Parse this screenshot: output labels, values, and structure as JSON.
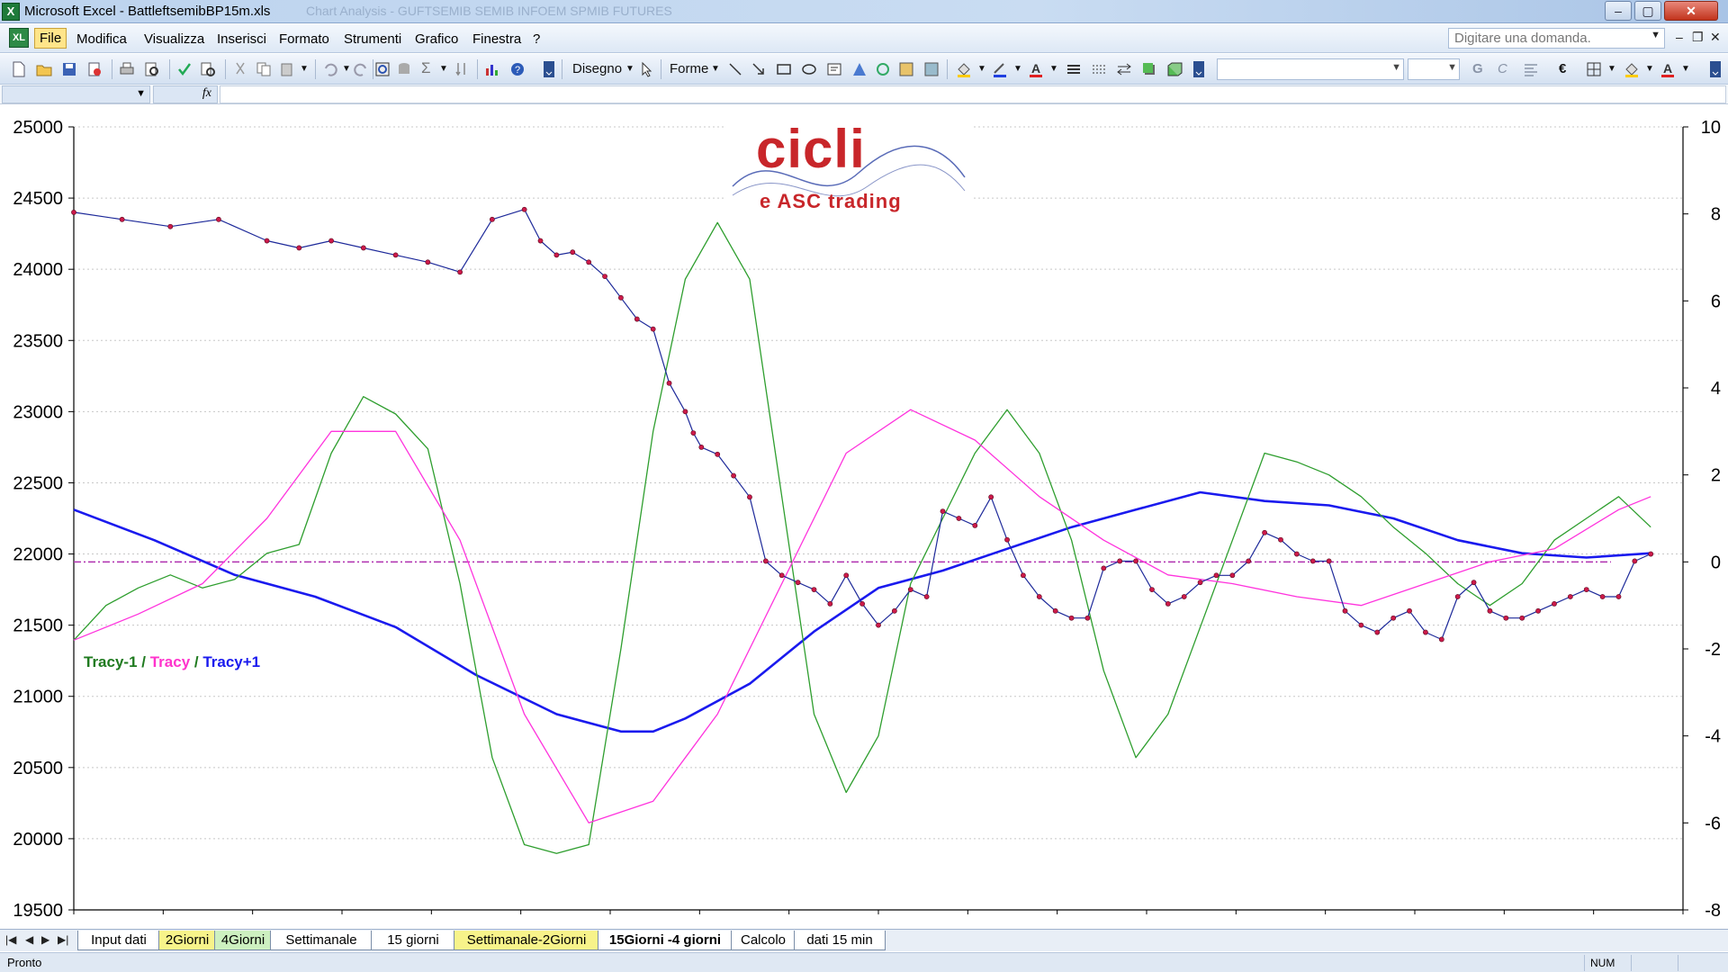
{
  "window": {
    "app_title": "Microsoft Excel - BattleftsemibBP15m.xls",
    "ghost_title": "Chart Analysis - GUFTSEMIB SEMIB INFOEM SPMIB FUTURES"
  },
  "menu": {
    "items": [
      "File",
      "Modifica",
      "Visualizza",
      "Inserisci",
      "Formato",
      "Strumenti",
      "Grafico",
      "Finestra",
      "?"
    ],
    "ask_placeholder": "Digitare una domanda."
  },
  "toolbar": {
    "draw_label": "Disegno",
    "shapes_label": "Forme",
    "bold_label": "G",
    "italic_label": "C",
    "euro_label": "€",
    "fx_label": "fx"
  },
  "chart": {
    "left_axis": {
      "min": 19500,
      "max": 25000,
      "step": 500,
      "ticks": [
        "25000",
        "24500",
        "24000",
        "23500",
        "23000",
        "22500",
        "22000",
        "21500",
        "21000",
        "20500",
        "20000",
        "19500"
      ]
    },
    "right_axis": {
      "min": -8,
      "max": 10,
      "step": 2,
      "ticks": [
        "10",
        "8",
        "6",
        "4",
        "2",
        "0",
        "-2",
        "-4",
        "-6",
        "-8"
      ]
    },
    "logo_main": "cicli",
    "logo_sub": "e ASC trading",
    "legend": [
      {
        "label": "Tracy-1",
        "color": "#1f7a1f"
      },
      {
        "label": " / ",
        "color": "#1f7a1f"
      },
      {
        "label": "Tracy",
        "color": "#ff33cc"
      },
      {
        "label": " / ",
        "color": "#1f7a1f"
      },
      {
        "label": "Tracy+1",
        "color": "#1a1aee"
      }
    ],
    "colors": {
      "price": "#1e2a9a",
      "price_marker": "#cc1a4a",
      "tracy_minus1": "#2e9e2e",
      "tracy": "#ff33dd",
      "tracy_plus1": "#1a1aee",
      "zero_line": "#b030b0"
    },
    "zero_line_value": 0
  },
  "chart_data": {
    "type": "line",
    "left_axis_range": [
      19500,
      25000
    ],
    "right_axis_range": [
      -8,
      10
    ],
    "x_range": [
      0,
      100
    ],
    "series": [
      {
        "axis": "left",
        "x": [
          0,
          3,
          6,
          9,
          12,
          14,
          16,
          18,
          20,
          22,
          24,
          26,
          28,
          29,
          30,
          31,
          32,
          33,
          34,
          35,
          36,
          37,
          38,
          38.5,
          39,
          40,
          41,
          42,
          43,
          44,
          45,
          46,
          47,
          48,
          49,
          50,
          51,
          52,
          53,
          54,
          55,
          56,
          57,
          58,
          59,
          60,
          61,
          62,
          63,
          64,
          65,
          66,
          67,
          68,
          69,
          70,
          71,
          72,
          73,
          74,
          75,
          76,
          77,
          78,
          79,
          80,
          81,
          82,
          83,
          84,
          85,
          86,
          87,
          88,
          89,
          90,
          91,
          92,
          93,
          94,
          95,
          96,
          97,
          98
        ],
        "values": [
          24400,
          24350,
          24300,
          24350,
          24200,
          24150,
          24200,
          24150,
          24100,
          24050,
          23980,
          24350,
          24420,
          24200,
          24100,
          24120,
          24050,
          23950,
          23800,
          23650,
          23580,
          23200,
          23000,
          22850,
          22750,
          22700,
          22550,
          22400,
          21950,
          21850,
          21800,
          21750,
          21650,
          21850,
          21650,
          21500,
          21600,
          21750,
          21700,
          22300,
          22250,
          22200,
          22400,
          22100,
          21850,
          21700,
          21600,
          21550,
          21550,
          21900,
          21950,
          21950,
          21750,
          21650,
          21700,
          21800,
          21850,
          21850,
          21950,
          22150,
          22100,
          22000,
          21950,
          21950,
          21600,
          21500,
          21450,
          21550,
          21600,
          21450,
          21400,
          21700,
          21800,
          21600,
          21550,
          21550,
          21600,
          21650,
          21700,
          21750,
          21700,
          21700,
          21950,
          22000
        ]
      },
      {
        "name": "Tracy-1",
        "axis": "right",
        "x": [
          0,
          2,
          4,
          6,
          8,
          10,
          12,
          14,
          16,
          18,
          20,
          22,
          24,
          26,
          28,
          30,
          32,
          34,
          36,
          38,
          40,
          42,
          44,
          46,
          48,
          50,
          52,
          54,
          56,
          58,
          60,
          62,
          64,
          66,
          68,
          70,
          72,
          74,
          76,
          78,
          80,
          82,
          84,
          86,
          88,
          90,
          92,
          94,
          96,
          98
        ],
        "values": [
          -1.8,
          -1.0,
          -0.6,
          -0.3,
          -0.6,
          -0.4,
          0.2,
          0.4,
          2.5,
          3.8,
          3.4,
          2.6,
          -0.5,
          -4.5,
          -6.5,
          -6.7,
          -6.5,
          -2.0,
          3.0,
          6.5,
          7.8,
          6.5,
          1.5,
          -3.5,
          -5.3,
          -4.0,
          -0.5,
          1.0,
          2.5,
          3.5,
          2.5,
          0.5,
          -2.5,
          -4.5,
          -3.5,
          -1.5,
          0.5,
          2.5,
          2.3,
          2.0,
          1.5,
          0.8,
          0.2,
          -0.5,
          -1.0,
          -0.5,
          0.5,
          1.0,
          1.5,
          0.8
        ]
      },
      {
        "name": "Tracy",
        "axis": "right",
        "x": [
          0,
          4,
          8,
          12,
          16,
          20,
          24,
          28,
          32,
          36,
          40,
          44,
          48,
          52,
          56,
          60,
          64,
          68,
          72,
          76,
          80,
          84,
          88,
          92,
          96,
          98
        ],
        "values": [
          -1.8,
          -1.2,
          -0.5,
          1.0,
          3.0,
          3.0,
          0.5,
          -3.5,
          -6.0,
          -5.5,
          -3.5,
          -0.5,
          2.5,
          3.5,
          2.8,
          1.5,
          0.5,
          -0.3,
          -0.5,
          -0.8,
          -1.0,
          -0.5,
          0.0,
          0.3,
          1.2,
          1.5
        ]
      },
      {
        "name": "Tracy+1",
        "axis": "right",
        "x": [
          0,
          5,
          10,
          15,
          20,
          25,
          30,
          34,
          36,
          38,
          42,
          46,
          50,
          54,
          58,
          62,
          66,
          70,
          74,
          78,
          82,
          86,
          90,
          94,
          98
        ],
        "values": [
          1.2,
          0.5,
          -0.3,
          -0.8,
          -1.5,
          -2.6,
          -3.5,
          -3.9,
          -3.9,
          -3.6,
          -2.8,
          -1.6,
          -0.6,
          -0.2,
          0.3,
          0.8,
          1.2,
          1.6,
          1.4,
          1.3,
          1.0,
          0.5,
          0.2,
          0.1,
          0.2
        ]
      }
    ]
  },
  "sheets": {
    "tabs": [
      "Input dati",
      "2Giorni",
      "4Giorni",
      "Settimanale",
      "15 giorni",
      "Settimanale-2Giorni",
      "15Giorni -4 giorni",
      "Calcolo",
      "dati 15 min"
    ],
    "active_index": 6
  },
  "status": {
    "text": "Pronto",
    "num": "NUM"
  }
}
